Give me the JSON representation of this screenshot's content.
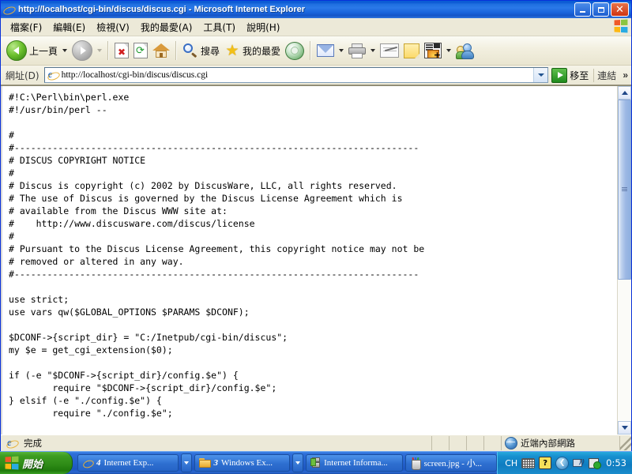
{
  "window": {
    "title": "http://localhost/cgi-bin/discus/discus.cgi - Microsoft Internet Explorer",
    "minimize_label": "",
    "maximize_label": "",
    "close_label": "✕"
  },
  "menubar": {
    "items": [
      {
        "label": "檔案(F)"
      },
      {
        "label": "編輯(E)"
      },
      {
        "label": "檢視(V)"
      },
      {
        "label": "我的最愛(A)"
      },
      {
        "label": "工具(T)"
      },
      {
        "label": "說明(H)"
      }
    ]
  },
  "toolbar": {
    "back_label": "上一頁",
    "forward_label": "",
    "stop_label": "",
    "refresh_label": "",
    "home_label": "",
    "search_label": "搜尋",
    "favorites_label": "我的最愛",
    "media_label": "",
    "mail_label": "",
    "print_label": "",
    "edit_label": "",
    "note_label": "",
    "discuss_label": "",
    "messenger_label": ""
  },
  "addressbar": {
    "label": "網址(D)",
    "value": "http://localhost/cgi-bin/discus/discus.cgi",
    "placeholder": "",
    "go_label": "移至",
    "links_label": "連結",
    "overflow_label": "»"
  },
  "content": {
    "code": "#!C:\\Perl\\bin\\perl.exe\n#!/usr/bin/perl --\n\n#\n#--------------------------------------------------------------------------\n# DISCUS COPYRIGHT NOTICE\n#\n# Discus is copyright (c) 2002 by DiscusWare, LLC, all rights reserved.\n# The use of Discus is governed by the Discus License Agreement which is\n# available from the Discus WWW site at:\n#    http://www.discusware.com/discus/license\n#\n# Pursuant to the Discus License Agreement, this copyright notice may not be\n# removed or altered in any way.\n#--------------------------------------------------------------------------\n\nuse strict;\nuse vars qw($GLOBAL_OPTIONS $PARAMS $DCONF);\n\n$DCONF->{script_dir} = \"C:/Inetpub/cgi-bin/discus\";\nmy $e = get_cgi_extension($0);\n\nif (-e \"$DCONF->{script_dir}/config.$e\") {\n        require \"$DCONF->{script_dir}/config.$e\";\n} elsif (-e \"./config.$e\") {\n        require \"./config.$e\";"
  },
  "scrollbar": {
    "thumb_percent": 56
  },
  "statusbar": {
    "message": "完成",
    "zone": "近端內部網路"
  },
  "taskbar": {
    "start_label": "開始",
    "buttons": [
      {
        "count": "4",
        "label": "Internet Exp...",
        "icon": "ie-icon",
        "grouped": true
      },
      {
        "count": "3",
        "label": "Windows Ex...",
        "icon": "folder-icon",
        "grouped": true
      },
      {
        "count": "",
        "label": "Internet Informa...",
        "icon": "server-icon",
        "grouped": false
      },
      {
        "count": "",
        "label": "screen.jpg - 小...",
        "icon": "paint-icon",
        "grouped": false
      }
    ],
    "tray": {
      "ime_label": "CH",
      "clock": "0:53",
      "icons": [
        "keyboard-icon",
        "help-icon",
        "show-hidden-icon",
        "network-icon",
        "volume-icon"
      ]
    }
  },
  "colors": {
    "titlebar_blue": "#1a64dc",
    "chrome_beige": "#ece9d8",
    "taskbar_blue": "#2562cd",
    "start_green": "#2f8c17",
    "tray_blue": "#0f7cc0",
    "desktop": "#5a7edc",
    "content_bg": "#ffffff"
  }
}
